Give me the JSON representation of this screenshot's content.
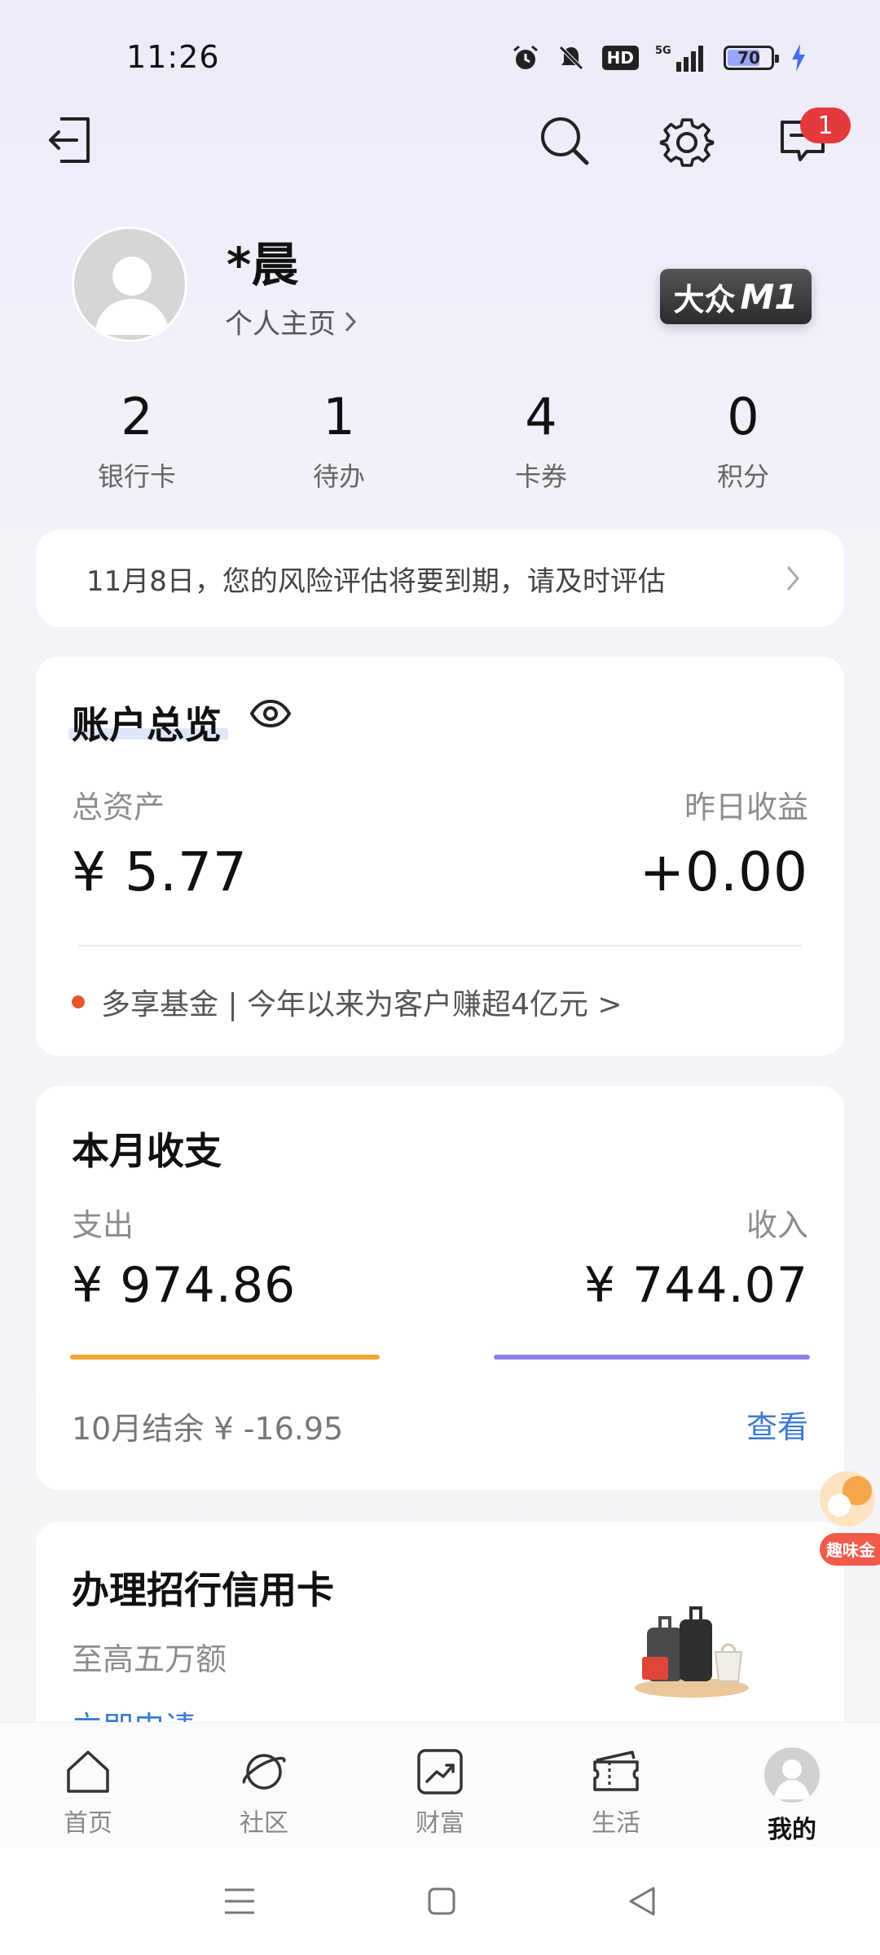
{
  "status_bar": {
    "time": "11:26",
    "hd_label": "HD",
    "network": "5G",
    "battery_level": "70"
  },
  "header": {
    "message_count": "1"
  },
  "profile": {
    "name": "*晨",
    "homepage_label": "个人主页",
    "level_badge_prefix": "大众",
    "level_badge_level": "M1"
  },
  "stats": [
    {
      "value": "2",
      "label": "银行卡"
    },
    {
      "value": "1",
      "label": "待办"
    },
    {
      "value": "4",
      "label": "卡券"
    },
    {
      "value": "0",
      "label": "积分"
    }
  ],
  "notice": {
    "text": "11月8日，您的风险评估将要到期，请及时评估"
  },
  "overview": {
    "title": "账户总览",
    "total_assets_label": "总资产",
    "total_assets_value": "¥ 5.77",
    "yesterday_label": "昨日收益",
    "yesterday_value": "+0.00",
    "promo": "多享基金 | 今年以来为客户赚超4亿元 >"
  },
  "monthly": {
    "title": "本月收支",
    "expense_label": "支出",
    "expense_value": "¥ 974.86",
    "income_label": "收入",
    "income_value": "¥ 744.07",
    "balance": "10月结余 ¥ -16.95",
    "view_label": "查看",
    "expense_color": "#f5a734",
    "income_color": "#8b80e8"
  },
  "credit_card": {
    "title": "办理招行信用卡",
    "subtitle": "至高五万额",
    "apply_link": "立即申请"
  },
  "float_widget": {
    "label": "趣味金"
  },
  "tabbar": [
    {
      "label": "首页",
      "icon": "home-icon"
    },
    {
      "label": "社区",
      "icon": "planet-icon"
    },
    {
      "label": "财富",
      "icon": "chart-icon"
    },
    {
      "label": "生活",
      "icon": "ticket-icon"
    },
    {
      "label": "我的",
      "icon": "avatar-icon",
      "active": true
    }
  ],
  "colors": {
    "accent_blue": "#3e7bd0",
    "badge_red": "#e5393d",
    "promo_dot": "#e7562d"
  }
}
